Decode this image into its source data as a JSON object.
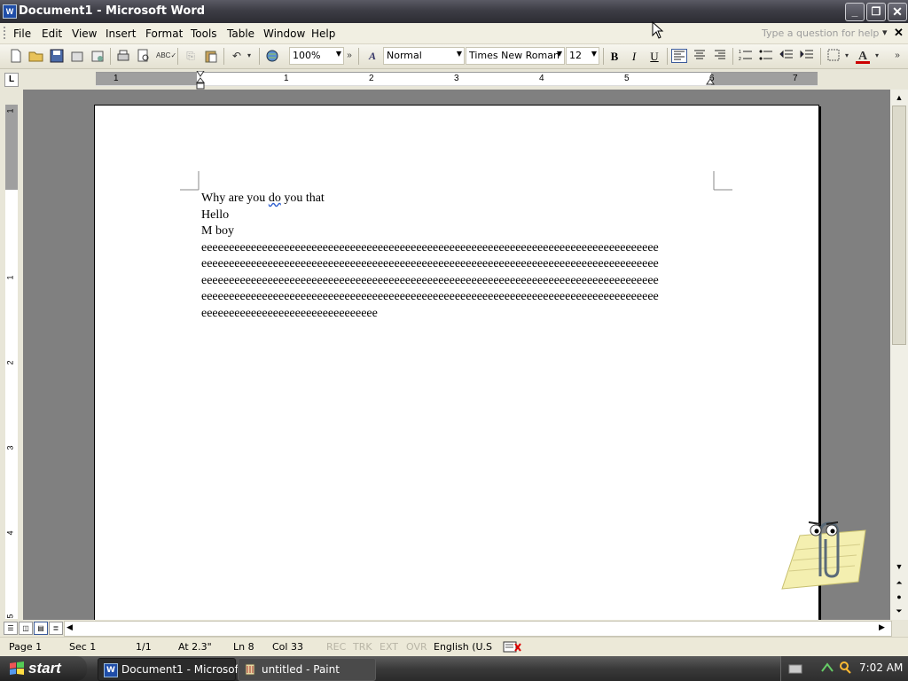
{
  "window": {
    "title": "Document1 - Microsoft Word",
    "app_icon": "W"
  },
  "menu": {
    "items": [
      "File",
      "Edit",
      "View",
      "Insert",
      "Format",
      "Tools",
      "Table",
      "Window",
      "Help"
    ],
    "help_placeholder": "Type a question for help",
    "close_glyph": "✕"
  },
  "toolbar": {
    "zoom": "100%",
    "style": "Normal",
    "font": "Times New Roman",
    "size": "12",
    "bold": "B",
    "italic": "I",
    "underline": "U",
    "font_color_letter": "A",
    "font_color": "#cc0000"
  },
  "ruler": {
    "numbers": [
      "1",
      "1",
      "2",
      "3",
      "4",
      "5",
      "6",
      "7"
    ]
  },
  "vruler": {
    "numbers": [
      "1",
      "1",
      "2",
      "3",
      "4",
      "5"
    ]
  },
  "document": {
    "lines": [
      "Why are you do you that",
      "Hello",
      "M boy",
      "eeeeeeeeeeeeeeeeeeeeeeeeeeeeeeeeeeeeeeeeeeeeeeeeeeeeeeeeeeeeeeeeeeeeeeeeeeeeeeeeeee",
      "eeeeeeeeeeeeeeeeeeeeeeeeeeeeeeeeeeeeeeeeeeeeeeeeeeeeeeeeeeeeeeeeeeeeeeeeeeeeeeeeeee",
      "eeeeeeeeeeeeeeeeeeeeeeeeeeeeeeeeeeeeeeeeeeeeeeeeeeeeeeeeeeeeeeeeeeeeeeeeeeeeeeeeeee",
      "eeeeeeeeeeeeeeeeeeeeeeeeeeeeeeeeeeeeeeeeeeeeeeeeeeeeeeeeeeeeeeeeeeeeeeeeeeeeeeeeeee",
      "eeeeeeeeeeeeeeeeeeeeeeeeeeeeeeee"
    ],
    "line1_parts": {
      "before": "Why are you ",
      "squiggle": "do",
      "after": " you that"
    }
  },
  "status": {
    "page": "Page 1",
    "sec": "Sec 1",
    "pages": "1/1",
    "at": "At 2.3\"",
    "ln": "Ln 8",
    "col": "Col 33",
    "rec": "REC",
    "trk": "TRK",
    "ext": "EXT",
    "ovr": "OVR",
    "language": "English (U.S"
  },
  "taskbar": {
    "start": "start",
    "tasks": [
      "Document1 - Microsof...",
      "untitled - Paint"
    ],
    "clock": "7:02 AM"
  },
  "colors": {
    "accent": "#1f4da8",
    "font_color_bar": "#cc0000"
  }
}
